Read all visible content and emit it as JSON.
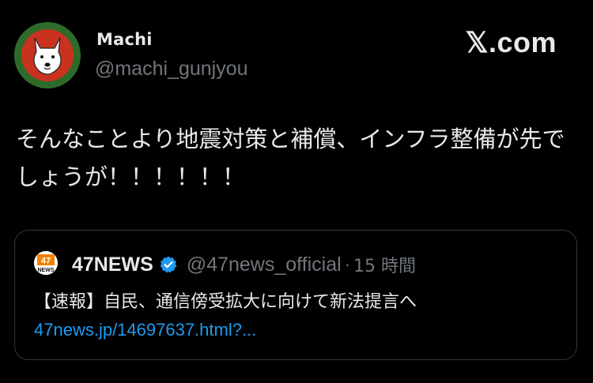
{
  "header": {
    "display_name": "Machi",
    "handle": "@machi_gunjyou",
    "platform_mark": "𝕏.com",
    "avatar_icon": "white-dog-avatar-icon",
    "avatar_bg": "#2e6b2a"
  },
  "tweet": {
    "text": "そんなことより地震対策と補償、インフラ整備が先でしょうが！！！！！！"
  },
  "quote": {
    "avatar_text": "47",
    "avatar_subtext": "NEWS",
    "name": "47NEWS",
    "verified_icon": "verified-badge-icon",
    "handle": "@47news_official",
    "separator": "·",
    "time": "15 時間",
    "text": "【速報】自民、通信傍受拡大に向けて新法提言へ",
    "link": "47news.jp/14697637.html?..."
  },
  "colors": {
    "background": "#000000",
    "text_primary": "#e7e9ea",
    "text_secondary": "#71767b",
    "link": "#1d9bf0",
    "border": "#333639",
    "verified": "#1d9bf0",
    "news_orange": "#f08300"
  }
}
